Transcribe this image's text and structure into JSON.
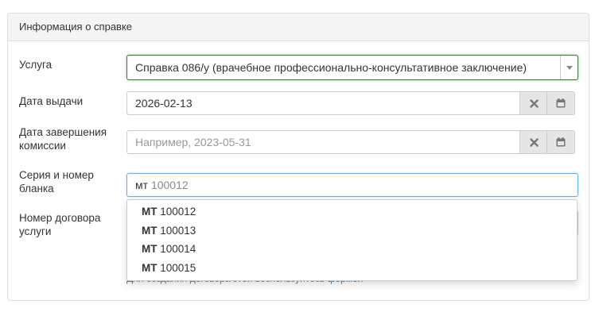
{
  "panel": {
    "title": "Информация о справке"
  },
  "fields": {
    "service": {
      "label": "Услуга",
      "value": "Справка 086/у (врачебное профессионально-консультативное заключение)"
    },
    "issue_date": {
      "label": "Дата выдачи",
      "value": "2026-02-13"
    },
    "commission_end_date": {
      "label_line1": "Дата завершения",
      "label_line2": "комиссии",
      "placeholder": "Например, 2023-05-31"
    },
    "blank_series_number": {
      "label_line1": "Серия и номер",
      "label_line2": "бланка",
      "prefix": "мт",
      "typed": "100012"
    },
    "contract_number": {
      "label_line1": "Номер договора",
      "label_line2": "услуги",
      "hint_text": "Для создания договора этой воспользуйтесь",
      "hint_link": "формой"
    }
  },
  "autocomplete": [
    {
      "series": "МТ",
      "number": "100012"
    },
    {
      "series": "МТ",
      "number": "100013"
    },
    {
      "series": "МТ",
      "number": "100014"
    },
    {
      "series": "МТ",
      "number": "100015"
    }
  ],
  "icons": {
    "select_arrow": "caret-down-icon",
    "clear": "close-icon",
    "calendar": "calendar-icon"
  },
  "colors": {
    "valid_border": "#3c763d",
    "focus_border": "#66afe9",
    "addon_bg": "#e6e6e6",
    "link": "#337ab7"
  }
}
